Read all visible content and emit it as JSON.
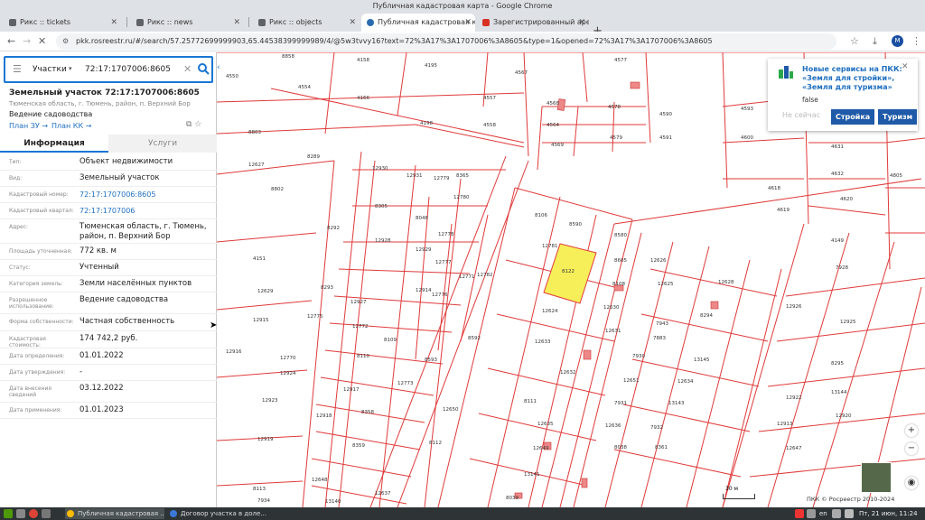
{
  "window": {
    "title": "Публичная кадастровая карта - Google Chrome"
  },
  "tabs": [
    {
      "label": "Рикс :: tickets"
    },
    {
      "label": "Рикс :: news"
    },
    {
      "label": "Рикс :: objects"
    },
    {
      "label": "Публичная кадастровая ка"
    },
    {
      "label": "Зарегистрированный аре"
    }
  ],
  "address": {
    "url": "pkk.rosreestr.ru/#/search/57.25772699999903,65.44538399999989/4/@5w3tvvy16?text=72%3A17%3A1707006%3A8605&type=1&opened=72%3A17%3A1707006%3A8605",
    "avatar": "M"
  },
  "search": {
    "type": "Участки",
    "value": "72:17:1707006:8605"
  },
  "parcel": {
    "title": "Земельный участок 72:17:1707006:8605",
    "address_short": "Тюменская область, г. Тюмень, район, п. Верхний Бор",
    "use": "Ведение садоводства",
    "link_plan_zu": "План ЗУ →",
    "link_plan_kk": "План КК →"
  },
  "panel_tabs": {
    "info": "Информация",
    "services": "Услуги"
  },
  "info_rows": [
    {
      "k": "Тип:",
      "v": "Объект недвижимости"
    },
    {
      "k": "Вид:",
      "v": "Земельный участок"
    },
    {
      "k": "Кадастровый номер:",
      "v": "72:17:1707006:8605"
    },
    {
      "k": "Кадастровый квартал:",
      "v": "72:17:1707006"
    },
    {
      "k": "Адрес:",
      "v": "Тюменская область, г. Тюмень, район, п. Верхний Бор"
    },
    {
      "k": "Площадь уточненная:",
      "v": "772 кв. м"
    },
    {
      "k": "Статус:",
      "v": "Учтенный"
    },
    {
      "k": "Категория земель:",
      "v": "Земли населённых пунктов"
    },
    {
      "k": "Разрешенное использование:",
      "v": "Ведение садоводства"
    },
    {
      "k": "Форма собственности:",
      "v": "Частная собственность"
    },
    {
      "k": "Кадастровая стоимость:",
      "v": "174 742,2 руб."
    },
    {
      "k": "Дата определения:",
      "v": "01.01.2022"
    },
    {
      "k": "Дата утверждения:",
      "v": "-"
    },
    {
      "k": "Дата внесения сведений",
      "v": "03.12.2022"
    },
    {
      "k": "Дата применения:",
      "v": "01.01.2023"
    }
  ],
  "popup": {
    "title": "Новые сервисы на ПКК: «Земля для стройки», «Земля для туризма»",
    "flag": "false",
    "btn_later": "Не сейчас",
    "btn_build": "Стройка",
    "btn_tourism": "Туризм"
  },
  "map": {
    "scale": "30 м",
    "copyright": "ПКК © Росреестр 2010-2024",
    "highlight_color": "#f6ef5a",
    "labels": [
      "8858",
      "4158",
      "4195",
      "4567",
      "4577",
      "4550",
      "4554",
      "4166",
      "4557",
      "4568",
      "4578",
      "4590",
      "4593",
      "4604",
      "4564",
      "4198",
      "4558",
      "4569",
      "4579",
      "4591",
      "4600",
      "4631",
      "4632",
      "4805",
      "4618",
      "4619",
      "4620",
      "4149",
      "8803",
      "8289",
      "12930",
      "12931",
      "12779",
      "8365",
      "12780",
      "8106",
      "8590",
      "8580",
      "12627",
      "8802",
      "8305",
      "8046",
      "12778",
      "12781",
      "8122",
      "8605",
      "12626",
      "12628",
      "7928",
      "4151",
      "8292",
      "12928",
      "12929",
      "12777",
      "12782",
      "8108",
      "12625",
      "12629",
      "8293",
      "12927",
      "12914",
      "12776",
      "12771",
      "12624",
      "12630",
      "7943",
      "8294",
      "12926",
      "12915",
      "12775",
      "12772",
      "8109",
      "8592",
      "12633",
      "12631",
      "7883",
      "12925",
      "12916",
      "12770",
      "8110",
      "8593",
      "12632",
      "7930",
      "13145",
      "8295",
      "12924",
      "12917",
      "12773",
      "8111",
      "12651",
      "12634",
      "13144",
      "12923",
      "12918",
      "8358",
      "12650",
      "12635",
      "7931",
      "13143",
      "12922",
      "12919",
      "8359",
      "8112",
      "12649",
      "12636",
      "7932",
      "12913",
      "12920",
      "8113",
      "12648",
      "12637",
      "13141",
      "8038",
      "8361",
      "12647",
      "7934",
      "13140",
      "8039",
      "8360",
      "8365"
    ],
    "icons": {
      "zoom_in": "+",
      "zoom_out": "−",
      "home": "⌂"
    }
  },
  "taskbar": {
    "apps": [
      {
        "label": "Публичная кадастровая ..."
      },
      {
        "label": "Договор участка в долe..."
      }
    ],
    "lang": "en",
    "clock": "Пт, 21 июн, 11:24"
  }
}
